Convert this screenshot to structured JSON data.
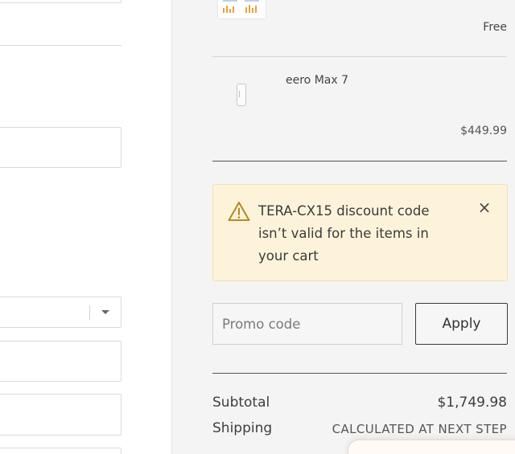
{
  "left_form": {
    "country_select_value": ""
  },
  "order_summary": {
    "items": [
      {
        "name": "",
        "price": "Free"
      },
      {
        "name": "eero Max 7",
        "price": "$449.99"
      }
    ],
    "alert": {
      "message": "TERA-CX15 discount code isn’t valid for the items in your cart",
      "close_label": "×"
    },
    "promo": {
      "placeholder": "Promo code",
      "value": "",
      "apply_label": "Apply"
    },
    "totals": {
      "subtotal_label": "Subtotal",
      "subtotal_value": "$1,749.98",
      "shipping_label": "Shipping",
      "shipping_value": "CALCULATED AT NEXT STEP"
    }
  },
  "colors": {
    "alert_background": "#fdf3db",
    "alert_icon": "#b58a1e",
    "summary_background": "#f4f4f4"
  },
  "icons": {
    "alert": "warning-triangle-icon",
    "close": "close-icon",
    "select": "chevron-down-icon"
  }
}
